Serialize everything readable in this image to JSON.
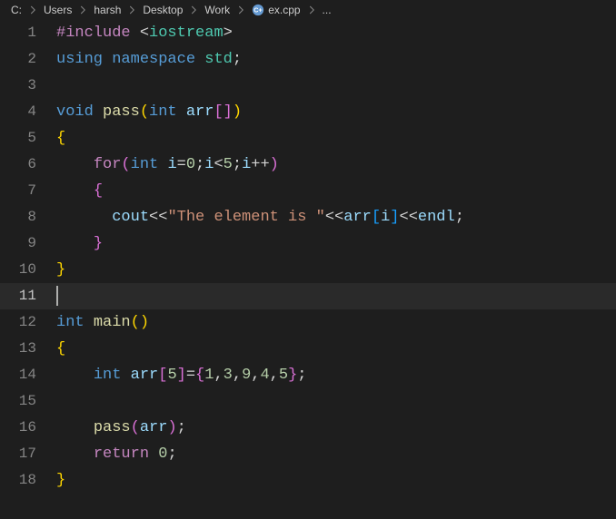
{
  "breadcrumb": {
    "segments": [
      "C:",
      "Users",
      "harsh",
      "Desktop",
      "Work",
      "ex.cpp",
      "..."
    ],
    "file_icon": "cpp-file-icon"
  },
  "active_line": 11,
  "lines": [
    {
      "n": 1,
      "tokens": [
        [
          "ctrl",
          "#include"
        ],
        [
          "op",
          " "
        ],
        [
          "punct",
          "<"
        ],
        [
          "ns",
          "iostream"
        ],
        [
          "punct",
          ">"
        ]
      ]
    },
    {
      "n": 2,
      "tokens": [
        [
          "kw",
          "using"
        ],
        [
          "op",
          " "
        ],
        [
          "kw",
          "namespace"
        ],
        [
          "op",
          " "
        ],
        [
          "ns",
          "std"
        ],
        [
          "punct",
          ";"
        ]
      ]
    },
    {
      "n": 3,
      "tokens": []
    },
    {
      "n": 4,
      "tokens": [
        [
          "type",
          "void"
        ],
        [
          "op",
          " "
        ],
        [
          "func",
          "pass"
        ],
        [
          "brace",
          "("
        ],
        [
          "type",
          "int"
        ],
        [
          "op",
          " "
        ],
        [
          "var",
          "arr"
        ],
        [
          "brace2",
          "["
        ],
        [
          "brace2",
          "]"
        ],
        [
          "brace",
          ")"
        ]
      ]
    },
    {
      "n": 5,
      "tokens": [
        [
          "brace",
          "{"
        ]
      ]
    },
    {
      "n": 6,
      "tokens": [
        [
          "op",
          "    "
        ],
        [
          "ctrl",
          "for"
        ],
        [
          "brace2",
          "("
        ],
        [
          "type",
          "int"
        ],
        [
          "op",
          " "
        ],
        [
          "var",
          "i"
        ],
        [
          "op",
          "="
        ],
        [
          "num",
          "0"
        ],
        [
          "punct",
          ";"
        ],
        [
          "var",
          "i"
        ],
        [
          "op",
          "<"
        ],
        [
          "num",
          "5"
        ],
        [
          "punct",
          ";"
        ],
        [
          "var",
          "i"
        ],
        [
          "op",
          "++"
        ],
        [
          "brace2",
          ")"
        ]
      ]
    },
    {
      "n": 7,
      "tokens": [
        [
          "op",
          "    "
        ],
        [
          "brace2",
          "{"
        ]
      ]
    },
    {
      "n": 8,
      "tokens": [
        [
          "op",
          "      "
        ],
        [
          "var",
          "cout"
        ],
        [
          "op",
          "<<"
        ],
        [
          "str",
          "\"The element is \""
        ],
        [
          "op",
          "<<"
        ],
        [
          "var",
          "arr"
        ],
        [
          "brace3",
          "["
        ],
        [
          "var",
          "i"
        ],
        [
          "brace3",
          "]"
        ],
        [
          "op",
          "<<"
        ],
        [
          "var",
          "endl"
        ],
        [
          "punct",
          ";"
        ]
      ]
    },
    {
      "n": 9,
      "tokens": [
        [
          "op",
          "    "
        ],
        [
          "brace2",
          "}"
        ]
      ]
    },
    {
      "n": 10,
      "tokens": [
        [
          "brace",
          "}"
        ]
      ]
    },
    {
      "n": 11,
      "tokens": [],
      "cursor": true
    },
    {
      "n": 12,
      "tokens": [
        [
          "type",
          "int"
        ],
        [
          "op",
          " "
        ],
        [
          "func",
          "main"
        ],
        [
          "brace",
          "("
        ],
        [
          "brace",
          ")"
        ]
      ]
    },
    {
      "n": 13,
      "tokens": [
        [
          "brace",
          "{"
        ]
      ]
    },
    {
      "n": 14,
      "tokens": [
        [
          "op",
          "    "
        ],
        [
          "type",
          "int"
        ],
        [
          "op",
          " "
        ],
        [
          "var",
          "arr"
        ],
        [
          "brace2",
          "["
        ],
        [
          "num",
          "5"
        ],
        [
          "brace2",
          "]"
        ],
        [
          "op",
          "="
        ],
        [
          "brace2",
          "{"
        ],
        [
          "num",
          "1"
        ],
        [
          "punct",
          ","
        ],
        [
          "num",
          "3"
        ],
        [
          "punct",
          ","
        ],
        [
          "num",
          "9"
        ],
        [
          "punct",
          ","
        ],
        [
          "num",
          "4"
        ],
        [
          "punct",
          ","
        ],
        [
          "num",
          "5"
        ],
        [
          "brace2",
          "}"
        ],
        [
          "punct",
          ";"
        ]
      ]
    },
    {
      "n": 15,
      "tokens": []
    },
    {
      "n": 16,
      "tokens": [
        [
          "op",
          "    "
        ],
        [
          "func",
          "pass"
        ],
        [
          "brace2",
          "("
        ],
        [
          "var",
          "arr"
        ],
        [
          "brace2",
          ")"
        ],
        [
          "punct",
          ";"
        ]
      ]
    },
    {
      "n": 17,
      "tokens": [
        [
          "op",
          "    "
        ],
        [
          "ctrl",
          "return"
        ],
        [
          "op",
          " "
        ],
        [
          "num",
          "0"
        ],
        [
          "punct",
          ";"
        ]
      ]
    },
    {
      "n": 18,
      "tokens": [
        [
          "brace",
          "}"
        ]
      ]
    }
  ]
}
